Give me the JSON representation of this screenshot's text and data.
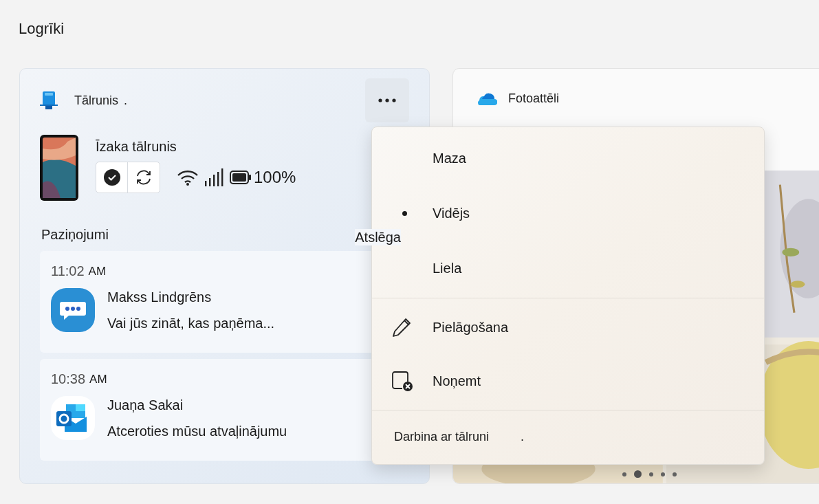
{
  "page_title": "Logrīki",
  "phone_widget": {
    "title": "Tālrunis",
    "title_mark": ".",
    "device_name": "Īzaka tālrunis",
    "battery": "100%",
    "notifications_heading": "Paziņojumi",
    "notifications_aside": "Atslēga",
    "notifications": [
      {
        "time": "11:02",
        "period": "AM",
        "sender": "Makss Lindgrēns",
        "message": "Vai jūs zināt, kas paņēma...",
        "kind": "chat"
      },
      {
        "time": "10:38",
        "period": "AM",
        "sender": "Juaņa Sakai",
        "message": "Atceroties mūsu atvaļinājumu",
        "kind": "mail"
      }
    ]
  },
  "photos_widget": {
    "title": "Fotoattēli",
    "pages": [
      {
        "selected": false
      },
      {
        "selected": true
      },
      {
        "selected": false
      },
      {
        "selected": false
      },
      {
        "selected": false
      }
    ]
  },
  "menu": {
    "items": [
      {
        "kind": "radio",
        "label": "Maza",
        "selected": false
      },
      {
        "kind": "radio",
        "label": "Vidējs",
        "selected": true
      },
      {
        "kind": "radio",
        "label": "Liela",
        "selected": false
      },
      {
        "kind": "separator"
      },
      {
        "kind": "edit",
        "label": "Pielāgošana"
      },
      {
        "kind": "remove",
        "label": "Noņemt"
      },
      {
        "kind": "separator"
      },
      {
        "kind": "link",
        "label": "Darbina ar tālruni",
        "suffix": "."
      }
    ]
  }
}
